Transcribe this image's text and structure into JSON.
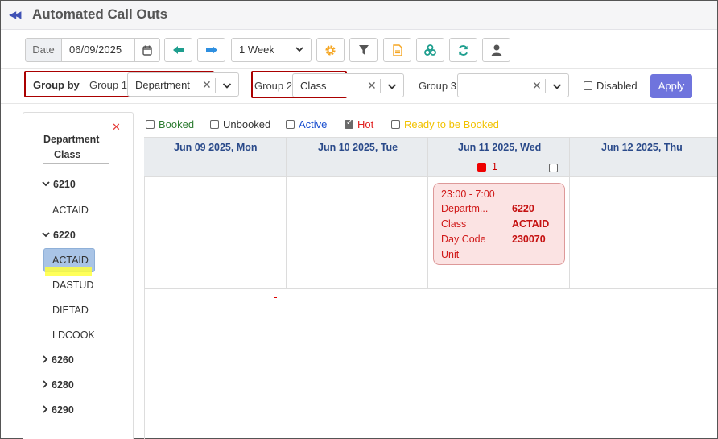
{
  "header": {
    "title": "Automated Call Outs",
    "collapse_icon": "double-chevron-left"
  },
  "toolbar": {
    "date_label": "Date",
    "date_value": "06/09/2025",
    "period": "1 Week",
    "icons": [
      "calendar-icon",
      "arrow-left-icon",
      "arrow-right-icon",
      "gear-icon",
      "filter-icon",
      "document-icon",
      "cluster-icon",
      "refresh-icon",
      "person-icon"
    ],
    "colors": {
      "arrow_left": "#1e9e8e",
      "arrow_right": "#2e8fe0",
      "gear": "#f5a623",
      "doc": "#f5a623",
      "cluster": "#1e9e8e",
      "refresh": "#1e9e8e",
      "person": "#555555"
    }
  },
  "grouping": {
    "label": "Group by",
    "group1_label": "Group 1",
    "group1_value": "Department",
    "group2_label": "Group 2",
    "group2_value": "Class",
    "group3_label": "Group 3",
    "group3_value": "",
    "disabled_label": "Disabled",
    "apply_label": "Apply"
  },
  "legend": [
    {
      "label": "Booked",
      "color": "#2e7d32",
      "checked": false
    },
    {
      "label": "Unbooked",
      "color": "#333333",
      "checked": false
    },
    {
      "label": "Active",
      "color": "#1a4fcf",
      "checked": false
    },
    {
      "label": "Hot",
      "color": "#e02020",
      "checked": true
    },
    {
      "label": "Ready to be Booked",
      "color": "#f2c200",
      "checked": false
    }
  ],
  "sidebar": {
    "header_line1": "Department",
    "header_line2": "Class",
    "tree": [
      {
        "label": "6210",
        "expanded": true,
        "children": [
          "ACTAID"
        ]
      },
      {
        "label": "6220",
        "expanded": true,
        "children": [
          "ACTAID",
          "DASTUD",
          "DIETAD",
          "LDCOOK"
        ],
        "selected_child": "ACTAID"
      },
      {
        "label": "6260",
        "expanded": false
      },
      {
        "label": "6280",
        "expanded": false
      },
      {
        "label": "6290",
        "expanded": false
      }
    ]
  },
  "calendar": {
    "days": [
      "Jun 09 2025, Mon",
      "Jun 10 2025, Tue",
      "Jun 11 2025, Wed",
      "Jun 12 2025, Thu"
    ],
    "hot_count": "1",
    "event": {
      "time": "23:00 - 7:00",
      "department_label": "Departm...",
      "department_value": "6220",
      "class_label": "Class",
      "class_value": "ACTAID",
      "daycode_label": "Day Code",
      "daycode_value": "230070",
      "unit_label": "Unit"
    }
  }
}
